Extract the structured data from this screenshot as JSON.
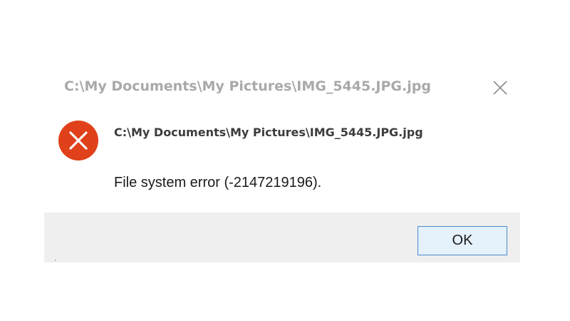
{
  "window": {
    "title": "C:\\My Documents\\My Pictures\\IMG_5445.JPG.jpg",
    "close_icon": "close-icon"
  },
  "content": {
    "icon": "error-icon",
    "heading": "C:\\My Documents\\My Pictures\\IMG_5445.JPG.jpg",
    "message": "File system error (-2147219196)."
  },
  "footer": {
    "ok_label": "OK"
  },
  "colors": {
    "error_red": "#e0401a",
    "footer_bg": "#efefef",
    "button_bg": "#e5f1fb",
    "button_border": "#4b8ccf"
  }
}
